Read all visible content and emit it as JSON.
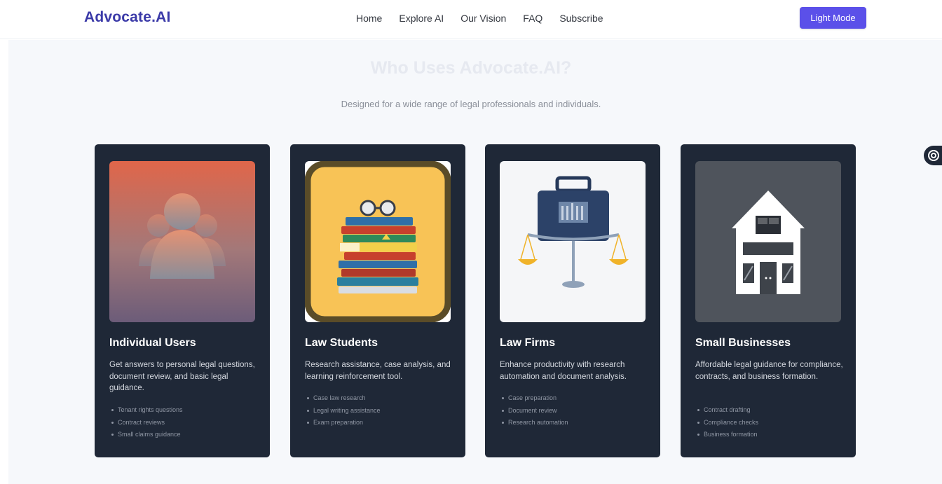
{
  "header": {
    "brand": "Advocate.AI",
    "nav": [
      "Home",
      "Explore AI",
      "Our Vision",
      "FAQ",
      "Subscribe"
    ],
    "mode_button": "Light Mode"
  },
  "section": {
    "title": "Who Uses Advocate.AI?",
    "subtitle": "Designed for a wide range of legal professionals and individuals."
  },
  "cards": [
    {
      "title": "Individual Users",
      "description": "Get answers to personal legal questions, document review, and basic legal guidance.",
      "items": [
        "Tenant rights questions",
        "Contract reviews",
        "Small claims guidance"
      ],
      "image_icon": "people-icon"
    },
    {
      "title": "Law Students",
      "description": "Research assistance, case analysis, and learning reinforcement tool.",
      "items": [
        "Case law research",
        "Legal writing assistance",
        "Exam preparation"
      ],
      "image_icon": "books-icon"
    },
    {
      "title": "Law Firms",
      "description": "Enhance productivity with research automation and document analysis.",
      "items": [
        "Case preparation",
        "Document review",
        "Research automation"
      ],
      "image_icon": "briefcase-scales-icon"
    },
    {
      "title": "Small Businesses",
      "description": "Affordable legal guidance for compliance, contracts, and business formation.",
      "items": [
        "Contract drafting",
        "Compliance checks",
        "Business formation"
      ],
      "image_icon": "building-icon"
    }
  ],
  "colors": {
    "brand": "#3b3aa8",
    "accent": "#5b50e9",
    "card_bg": "#1f2837",
    "section_bg": "#f6f8fb"
  }
}
